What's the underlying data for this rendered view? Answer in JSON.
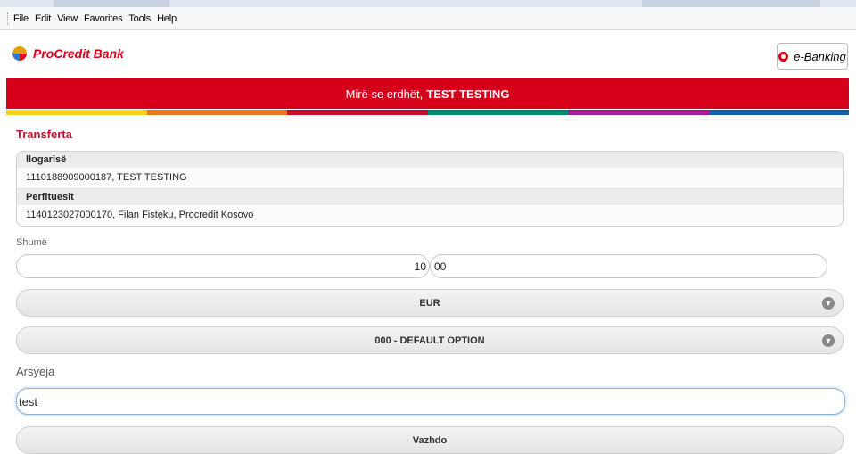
{
  "menu": [
    "File",
    "Edit",
    "View",
    "Favorites",
    "Tools",
    "Help"
  ],
  "header": {
    "logo_text": "ProCredit Bank",
    "ebanking_label": "e-Banking"
  },
  "welcome": {
    "prefix": "Mirë se erdhët,",
    "name": "TEST TESTING"
  },
  "colorbar": [
    "#f7d117",
    "#e87722",
    "#c8102e",
    "#008c72",
    "#a1208e",
    "#1a5ea8"
  ],
  "section_title": "Transferta",
  "account": {
    "label": "llogarisë",
    "value": "1110188909000187, TEST TESTING"
  },
  "beneficiary": {
    "label": "Perfituesit",
    "value": "1140123027000170, Filan Fisteku, Procredit Kosovo"
  },
  "amount": {
    "label": "Shumë",
    "whole": "10",
    "decimal": "00"
  },
  "currency": {
    "selected": "EUR"
  },
  "option": {
    "selected": "000 - DEFAULT OPTION"
  },
  "reason": {
    "label": "Arsyeja",
    "value": "test"
  },
  "continue_label": "Vazhdo"
}
